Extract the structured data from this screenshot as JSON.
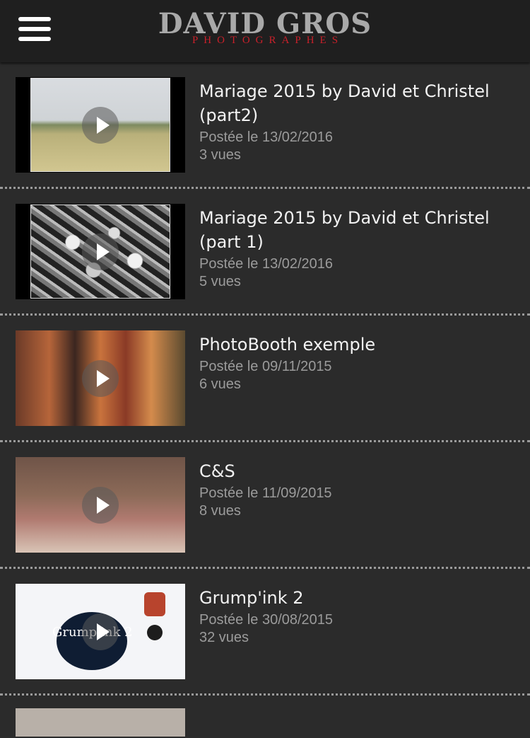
{
  "header": {
    "logo_main": "DAVID GROS",
    "logo_sub": "PHOTOGRAPHES",
    "menu_icon": "hamburger-menu-icon"
  },
  "colors": {
    "background": "#2b2b2b",
    "header": "#1f1f1f",
    "logo_main": "#a9a9a9",
    "logo_sub": "#c8202a",
    "title": "#f2f2f2",
    "meta": "#9b9b9b"
  },
  "videos": [
    {
      "title": "Mariage 2015 by David et Christel (part2)",
      "posted": "Postée le 13/02/2016",
      "views": "3 vues"
    },
    {
      "title": "Mariage 2015 by David et Christel (part 1)",
      "posted": "Postée le 13/02/2016",
      "views": "5 vues"
    },
    {
      "title": "PhotoBooth exemple",
      "posted": "Postée le 09/11/2015",
      "views": "6 vues"
    },
    {
      "title": "C&S",
      "posted": "Postée le 11/09/2015",
      "views": "8 vues"
    },
    {
      "title": "Grump'ink 2",
      "posted": "Postée le 30/08/2015",
      "views": "32 vues"
    }
  ],
  "grump_badge_text": "Grump'ink 2"
}
